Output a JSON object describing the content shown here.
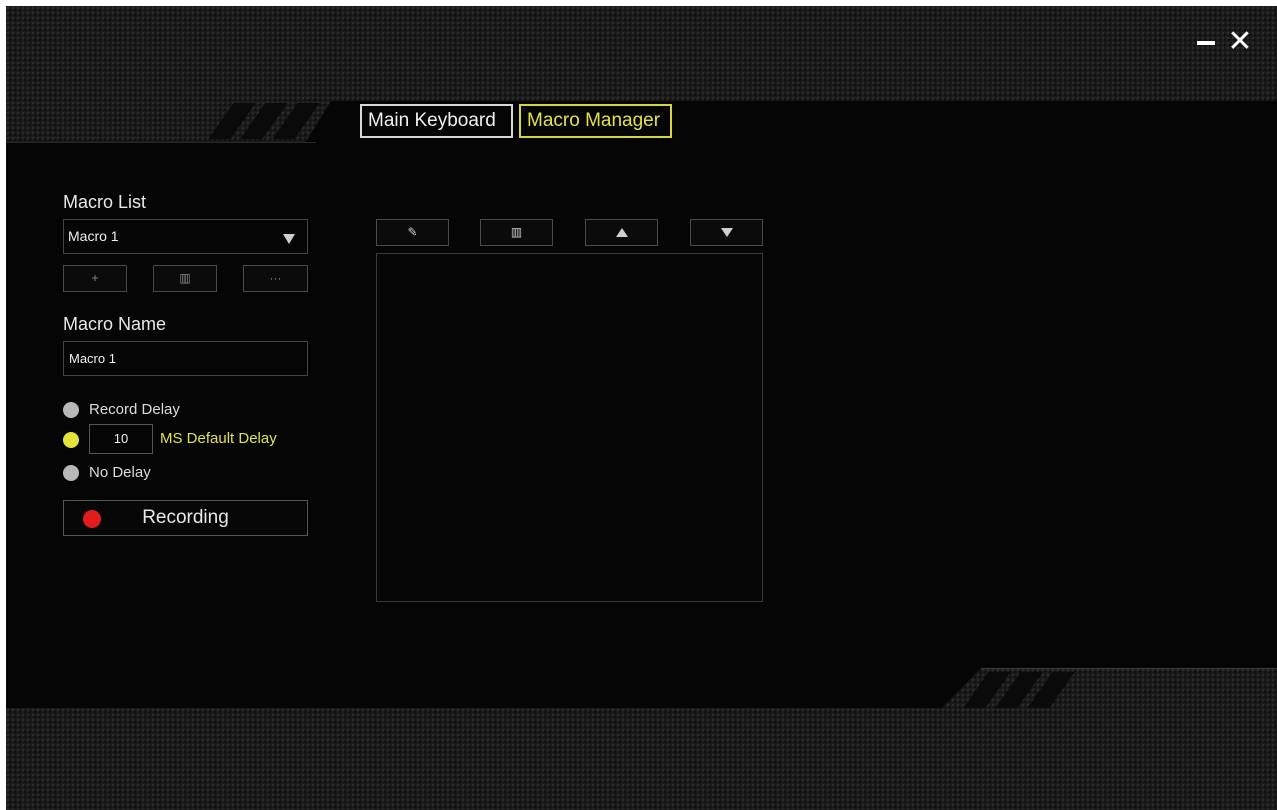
{
  "window": {
    "minimize_icon": "minimize-icon",
    "close_icon": "close-icon",
    "close_glyph": "✕"
  },
  "tabs": [
    {
      "label": "Main Keyboard",
      "active": false
    },
    {
      "label": "Macro Manager",
      "active": true
    }
  ],
  "colors": {
    "accent": "#e3e34a",
    "record": "#e01c1c",
    "background": "#050505"
  },
  "macro_list": {
    "label": "Macro List",
    "selected": "Macro 1",
    "add_glyph": "+",
    "delete_glyph": "▥",
    "more_glyph": "···"
  },
  "macro_name": {
    "label": "Macro Name",
    "value": "Macro 1"
  },
  "delay_options": {
    "record_delay": "Record Delay",
    "default_delay_value": "10",
    "default_delay_label": "MS Default Delay",
    "no_delay": "No Delay",
    "selected": "default_delay"
  },
  "recording": {
    "label": "Recording"
  },
  "editor_toolbar": {
    "edit_glyph": "✎",
    "delete_glyph": "▥"
  }
}
